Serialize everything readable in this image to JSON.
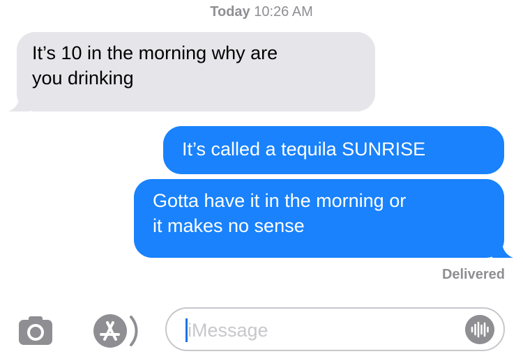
{
  "header": {
    "day": "Today",
    "time": "10:26 AM"
  },
  "messages": [
    {
      "direction": "incoming",
      "lines": [
        "It’s 10 in the morning why are",
        "you drinking"
      ]
    },
    {
      "direction": "outgoing",
      "lines": [
        "It’s called a tequila SUNRISE"
      ]
    },
    {
      "direction": "outgoing",
      "lines": [
        "Gotta have it in the morning or",
        "it makes no sense"
      ]
    }
  ],
  "status": "Delivered",
  "composer": {
    "placeholder": "iMessage",
    "left_icons": [
      "camera-icon",
      "app-store-icon"
    ],
    "right_icon": "audio-waveform-icon"
  },
  "colors": {
    "incoming_bubble": "#e5e5ea",
    "outgoing_bubble": "#1982fc",
    "meta_text": "#8e8e93"
  }
}
